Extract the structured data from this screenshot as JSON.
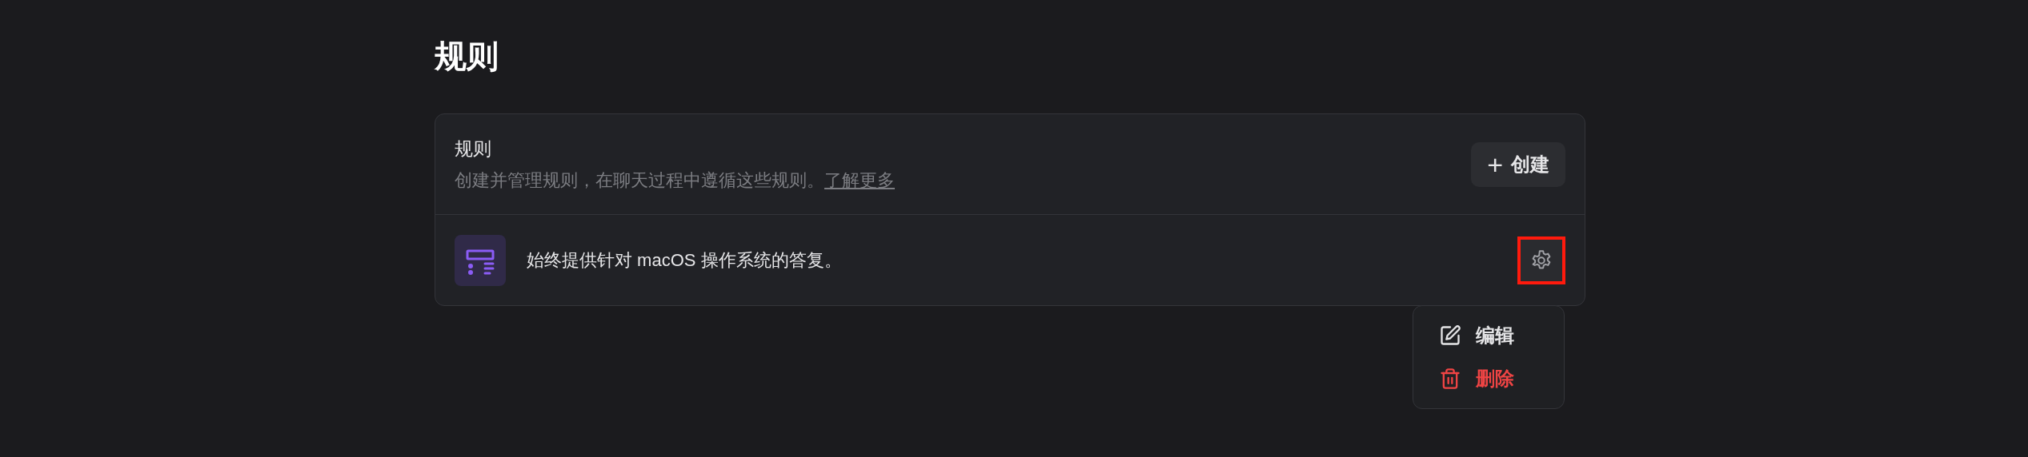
{
  "page_title": "规则",
  "card": {
    "title": "规则",
    "description": "创建并管理规则，在聊天过程中遵循这些规则。",
    "learn_more": "了解更多",
    "create_button": {
      "icon": "+",
      "label": "创建"
    }
  },
  "rules": [
    {
      "text": "始终提供针对 macOS 操作系统的答复。",
      "settings_highlighted": true
    }
  ],
  "menu": [
    {
      "kind": "edit",
      "label": "编辑"
    },
    {
      "kind": "delete",
      "label": "删除"
    }
  ]
}
